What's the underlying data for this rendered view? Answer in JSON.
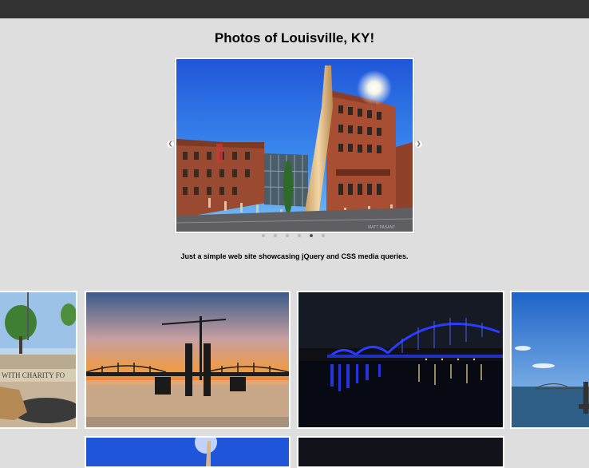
{
  "page": {
    "title": "Photos of Louisville, KY!",
    "tagline": "Just a simple web site showcasing jQuery and CSS media queries."
  },
  "slider": {
    "prev_icon": "chevron-left-icon",
    "next_icon": "chevron-right-icon",
    "slide_count": 6,
    "active_slide": 5,
    "current_image": "louisville-slugger-museum-bat",
    "watermark": "MATT PASANT"
  },
  "gallery": {
    "thumbnails": [
      {
        "subject": "waterfront-park-sign",
        "sign_text": "WITH CHARITY FO"
      },
      {
        "subject": "bridge-construction-sunset"
      },
      {
        "subject": "big-four-bridge-night-blue"
      },
      {
        "subject": "ohio-river-bridge-day"
      },
      {
        "subject": "slugger-museum-second-row"
      },
      {
        "subject": "night-scene-second-row"
      }
    ]
  },
  "colors": {
    "background": "#dedede",
    "topbar": "#333333",
    "frame": "#ffffff"
  }
}
